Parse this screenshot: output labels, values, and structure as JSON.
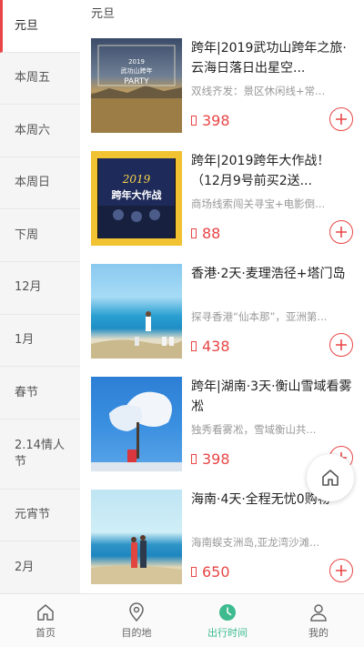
{
  "sidebar": {
    "items": [
      {
        "label": "元旦",
        "active": true
      },
      {
        "label": "本周五"
      },
      {
        "label": "本周六"
      },
      {
        "label": "本周日"
      },
      {
        "label": "下周"
      },
      {
        "label": "12月"
      },
      {
        "label": "1月"
      },
      {
        "label": "春节"
      },
      {
        "label": "2.14情人节"
      },
      {
        "label": "元宵节"
      },
      {
        "label": "2月"
      }
    ]
  },
  "main": {
    "section_title": "元旦",
    "cards": [
      {
        "title": "跨年|2019武功山跨年之旅·云海日落日出星空...",
        "subtitle": "双线齐发：景区休闲线+常...",
        "price": "398",
        "thumb_text": [
          "2019",
          "武功山跨年",
          "PARTY"
        ]
      },
      {
        "title": "跨年|2019跨年大作战！（12月9号前买2送...",
        "subtitle": "商场线索闯关寻宝+电影倒...",
        "price": "88",
        "thumb_text": [
          "2019",
          "跨年大作战"
        ]
      },
      {
        "title": "香港·2天·麦理浩径+塔门岛",
        "subtitle": "探寻香港“仙本那”，亚洲第...",
        "price": "438"
      },
      {
        "title": "跨年|湖南·3天·衡山雪域看雾凇",
        "subtitle": "独秀看雾凇，雪域衡山共...",
        "price": "398"
      },
      {
        "title": "海南·4天·全程无忧0购物",
        "subtitle": "海南蜈支洲岛,亚龙湾沙滩...",
        "price": "650"
      }
    ]
  },
  "tabbar": {
    "tabs": [
      {
        "label": "首页",
        "icon": "home-icon"
      },
      {
        "label": "目的地",
        "icon": "location-pin-icon"
      },
      {
        "label": "出行时间",
        "icon": "clock-icon",
        "active": true
      },
      {
        "label": "我的",
        "icon": "user-icon"
      }
    ]
  },
  "colors": {
    "accent_red": "#e84646",
    "active_tab_green": "#3dbb8f"
  }
}
